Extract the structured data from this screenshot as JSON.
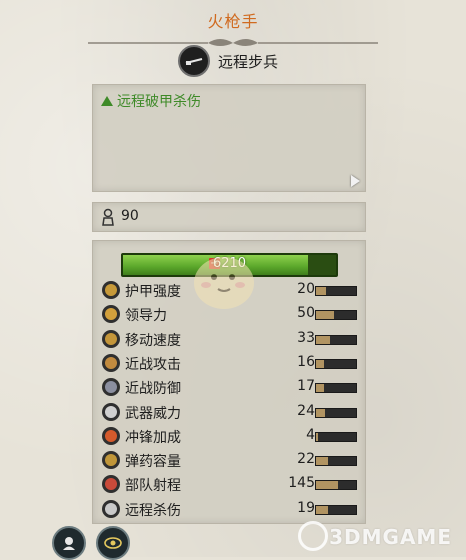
{
  "window": {
    "title": "火枪手"
  },
  "unit": {
    "type_label": "远程步兵",
    "type_icon": "musket-icon"
  },
  "traits": [
    {
      "label": "远程破甲杀伤",
      "polarity": "positive",
      "color": "#3e8a28"
    }
  ],
  "cost": {
    "value": "90",
    "icon": "unit-upkeep-icon"
  },
  "health": {
    "value": "6210",
    "fraction": 0.87,
    "color": "#5aa62a"
  },
  "stats": [
    {
      "label": "护甲强度",
      "value": "20",
      "icon": "armor-icon",
      "fraction": 0.25
    },
    {
      "label": "领导力",
      "value": "50",
      "icon": "leadership-icon",
      "fraction": 0.45
    },
    {
      "label": "移动速度",
      "value": "33",
      "icon": "speed-icon",
      "fraction": 0.35
    },
    {
      "label": "近战攻击",
      "value": "16",
      "icon": "melee-attack-icon",
      "fraction": 0.2
    },
    {
      "label": "近战防御",
      "value": "17",
      "icon": "melee-defense-icon",
      "fraction": 0.2
    },
    {
      "label": "武器威力",
      "value": "24",
      "icon": "weapon-strength-icon",
      "fraction": 0.22
    },
    {
      "label": "冲锋加成",
      "value": "4",
      "icon": "charge-bonus-icon",
      "fraction": 0.06
    },
    {
      "label": "弹药容量",
      "value": "22",
      "icon": "ammunition-icon",
      "fraction": 0.3
    },
    {
      "label": "部队射程",
      "value": "145",
      "icon": "range-icon",
      "fraction": 0.55
    },
    {
      "label": "远程杀伤",
      "value": "19",
      "icon": "missile-damage-icon",
      "fraction": 0.3
    }
  ],
  "buttons": {
    "info_icon": "unit-card-icon",
    "eye_icon": "eye-icon"
  },
  "watermark": "3DMGAME",
  "colors": {
    "title": "#d06a1f",
    "stat_bar": "#b19462"
  }
}
